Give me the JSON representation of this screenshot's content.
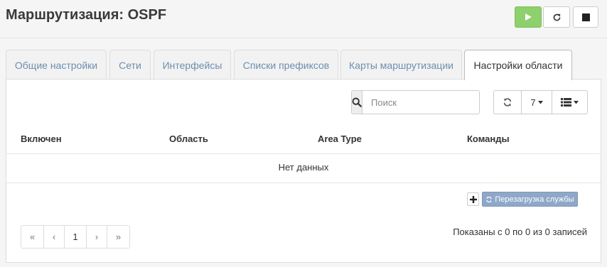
{
  "header": {
    "title": "Маршрутизация: OSPF",
    "colors": {
      "play": "#8ecf6e"
    }
  },
  "tabs": [
    {
      "label": "Общие настройки"
    },
    {
      "label": "Сети"
    },
    {
      "label": "Интерфейсы"
    },
    {
      "label": "Списки префиксов"
    },
    {
      "label": "Карты маршрутизации"
    },
    {
      "label": "Настройки области",
      "active": true
    }
  ],
  "toolbar": {
    "search_placeholder": "Поиск",
    "rows_per_page": "7"
  },
  "table": {
    "columns": [
      "Включен",
      "Область",
      "Area Type",
      "Команды"
    ],
    "empty_text": "Нет данных"
  },
  "actions": {
    "reload_label": "Перезагрузка службы",
    "reload_color": "#8fa8c8"
  },
  "pagination": {
    "first": "«",
    "prev": "‹",
    "current_page": "1",
    "next": "›",
    "last": "»",
    "summary": "Показаны с 0 по 0 из 0 записей"
  }
}
